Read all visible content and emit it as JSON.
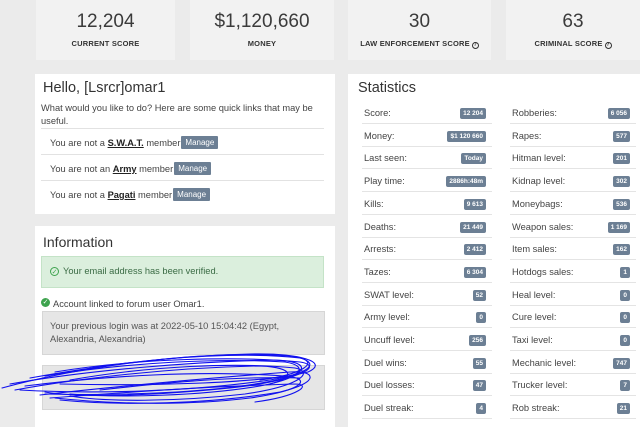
{
  "top_stats": [
    {
      "value": "12,204",
      "label": "CURRENT SCORE",
      "help": false
    },
    {
      "value": "$1,120,660",
      "label": "MONEY",
      "help": false
    },
    {
      "value": "30",
      "label": "LAW ENFORCEMENT SCORE",
      "help": true
    },
    {
      "value": "63",
      "label": "CRIMINAL SCORE",
      "help": true
    }
  ],
  "hello": {
    "title": "Hello, [Lsrcr]omar1",
    "description": "What would you like to do? Here are some quick links that may be useful.",
    "memberships": [
      {
        "prefix": "You are not a ",
        "group": "S.W.A.T.",
        "suffix": " member",
        "button": "Manage"
      },
      {
        "prefix": "You are not an ",
        "group": "Army",
        "suffix": " member",
        "button": "Manage"
      },
      {
        "prefix": "You are not a ",
        "group": "Pagati",
        "suffix": " member",
        "button": "Manage"
      }
    ]
  },
  "information": {
    "title": "Information",
    "email_verified": "Your email address has been verified.",
    "linked_account": "Account linked to forum user Omar1.",
    "previous_login": "Your previous login was at 2022-05-10 15:04:42 (Egypt, Alexandria, Alexandria)"
  },
  "statistics": {
    "title": "Statistics",
    "left": [
      {
        "label": "Score:",
        "value": "12 204"
      },
      {
        "label": "Money:",
        "value": "$1 120 660"
      },
      {
        "label": "Last seen:",
        "value": "Today"
      },
      {
        "label": "Play time:",
        "value": "2886h:48m"
      },
      {
        "label": "Kills:",
        "value": "9 613"
      },
      {
        "label": "Deaths:",
        "value": "21 449"
      },
      {
        "label": "Arrests:",
        "value": "2 412"
      },
      {
        "label": "Tazes:",
        "value": "6 304"
      },
      {
        "label": "SWAT level:",
        "value": "52"
      },
      {
        "label": "Army level:",
        "value": "0"
      },
      {
        "label": "Uncuff level:",
        "value": "256"
      },
      {
        "label": "Duel wins:",
        "value": "55"
      },
      {
        "label": "Duel losses:",
        "value": "47"
      },
      {
        "label": "Duel streak:",
        "value": "4"
      }
    ],
    "right": [
      {
        "label": "Robberies:",
        "value": "6 056"
      },
      {
        "label": "Rapes:",
        "value": "577"
      },
      {
        "label": "Hitman level:",
        "value": "201"
      },
      {
        "label": "Kidnap level:",
        "value": "302"
      },
      {
        "label": "Moneybags:",
        "value": "536"
      },
      {
        "label": "Weapon sales:",
        "value": "1 169"
      },
      {
        "label": "Item sales:",
        "value": "162"
      },
      {
        "label": "Hotdogs sales:",
        "value": "1"
      },
      {
        "label": "Heal level:",
        "value": "0"
      },
      {
        "label": "Cure level:",
        "value": "0"
      },
      {
        "label": "Taxi level:",
        "value": "0"
      },
      {
        "label": "Mechanic level:",
        "value": "747"
      },
      {
        "label": "Trucker level:",
        "value": "7"
      },
      {
        "label": "Rob streak:",
        "value": "21"
      }
    ]
  },
  "colors": {
    "badge": "#6c7f94",
    "success_bg": "#dbefdd",
    "success_icon": "#3ea34e",
    "scribble": "#1010ee"
  }
}
